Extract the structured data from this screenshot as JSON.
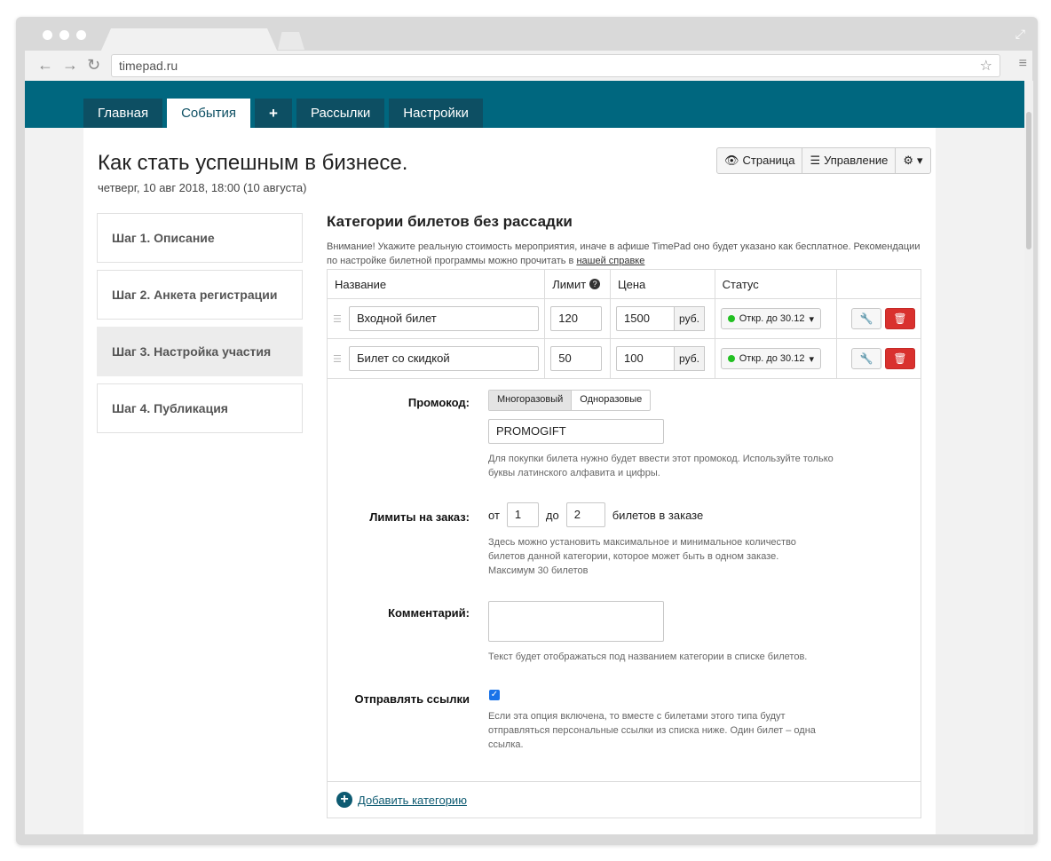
{
  "browser": {
    "url": "timepad.ru"
  },
  "nav": {
    "tabs": [
      "Главная",
      "События",
      "+",
      "Рассылки",
      "Настройки"
    ]
  },
  "event": {
    "title": "Как стать успешным в бизнесе.",
    "date": "четверг, 10 авг 2018, 18:00 (10 августа)"
  },
  "actions": {
    "page": "Страница",
    "manage": "Управление"
  },
  "steps": [
    "Шаг 1. Описание",
    "Шаг 2. Анкета регистрации",
    "Шаг 3. Настройка участия",
    "Шаг 4. Публикация"
  ],
  "section": {
    "title": "Категории билетов без рассадки",
    "notice": "Внимание! Укажите реальную стоимость мероприятия, иначе в афише TimePad оно будет указано как бесплатное. Рекомендации по настройке билетной программы можно прочитать в ",
    "notice_link": "нашей справке"
  },
  "table": {
    "headers": {
      "name": "Название",
      "limit": "Лимит",
      "price": "Цена",
      "status": "Статус"
    },
    "currency": "руб.",
    "rows": [
      {
        "name": "Входной билет",
        "limit": "120",
        "price": "1500",
        "status": "Откр. до 30.12"
      },
      {
        "name": "Билет со скидкой",
        "limit": "50",
        "price": "100",
        "status": "Откр. до 30.12"
      }
    ]
  },
  "promo": {
    "label": "Промокод:",
    "options": [
      "Многоразовый",
      "Одноразовые"
    ],
    "value": "PROMOGIFT",
    "help": "Для покупки билета нужно будет ввести этот промокод. Используйте только буквы латинского алфавита и цифры."
  },
  "limits": {
    "label": "Лимиты на заказ:",
    "from_label": "от",
    "from": "1",
    "to_label": "до",
    "to": "2",
    "suffix": "билетов в заказе",
    "help": "Здесь можно установить максимальное и минимальное количество билетов данной категории, которое может быть в одном заказе. Максимум 30 билетов"
  },
  "comment": {
    "label": "Комментарий:",
    "help": "Текст будет отображаться под названием категории в списке билетов."
  },
  "links": {
    "label": "Отправлять ссылки",
    "checked": true,
    "help": "Если эта опция включена, то вместе с билетами этого типа будут отправляться персональные ссылки из списка ниже. Один билет – одна ссылка."
  },
  "add_category": "Добавить категорию"
}
